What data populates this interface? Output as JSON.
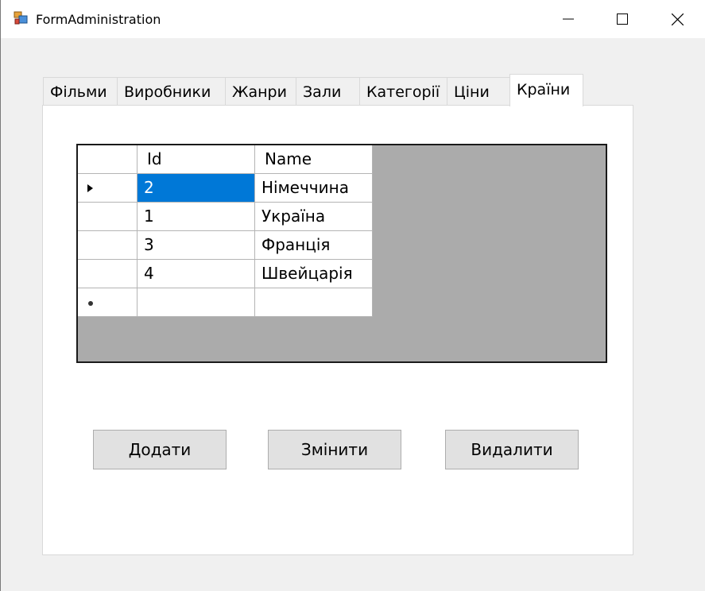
{
  "window": {
    "title": "FormAdministration"
  },
  "tabs": [
    {
      "label": "Фільми"
    },
    {
      "label": "Виробники"
    },
    {
      "label": "Жанри"
    },
    {
      "label": "Зали"
    },
    {
      "label": "Категорії"
    },
    {
      "label": "Ціни"
    },
    {
      "label": "Країни",
      "active": true
    }
  ],
  "grid": {
    "columns": [
      "Id",
      "Name"
    ],
    "rows": [
      {
        "id": "2",
        "name": "Німеччина",
        "current": true
      },
      {
        "id": "1",
        "name": "Україна"
      },
      {
        "id": "3",
        "name": "Франція"
      },
      {
        "id": "4",
        "name": "Швейцарія"
      }
    ],
    "new_row": {
      "id": "",
      "name": ""
    }
  },
  "buttons": {
    "add": "Додати",
    "edit": "Змінити",
    "delete": "Видалити"
  },
  "icons": {
    "app": "app-icon",
    "minimize": "minimize-icon",
    "maximize": "maximize-icon",
    "close": "close-icon",
    "current_row": "triangle-right-icon",
    "new_row": "asterisk-icon"
  },
  "colors": {
    "selection": "#0078d7",
    "grid_background": "#ababab",
    "button_face": "#e1e1e1"
  }
}
